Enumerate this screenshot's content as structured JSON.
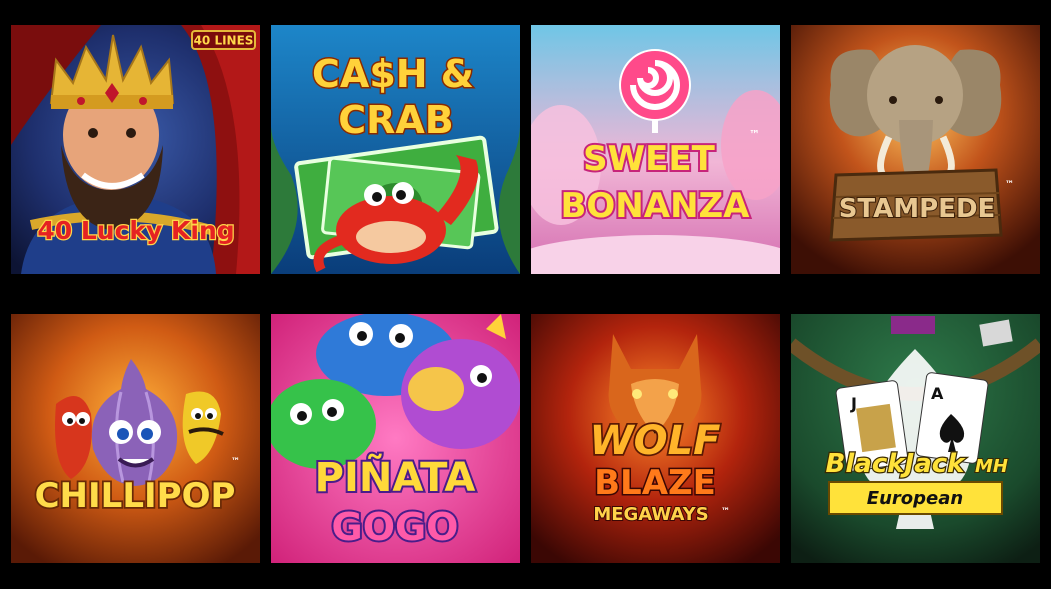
{
  "games": [
    {
      "title_line1": "40 Lucky King",
      "badge": "40 LINES"
    },
    {
      "title_line1": "CA$H &",
      "title_line2": "CRAB"
    },
    {
      "title_line1": "SWEET",
      "title_line2": "BONANZA",
      "tm": "™"
    },
    {
      "title_line1": "STAMPEDE",
      "tm": "™"
    },
    {
      "title_line1": "CHILLIPOP",
      "tm": "™"
    },
    {
      "title_line1": "PIÑATA",
      "title_line2": "GOGO"
    },
    {
      "title_line1": "WOLF",
      "title_line2": "BLAZE",
      "title_line3": "MEGAWAYS",
      "tm": "™"
    },
    {
      "title_line1": "BlackJack",
      "title_suffix": "MH",
      "title_line2": "European"
    }
  ]
}
